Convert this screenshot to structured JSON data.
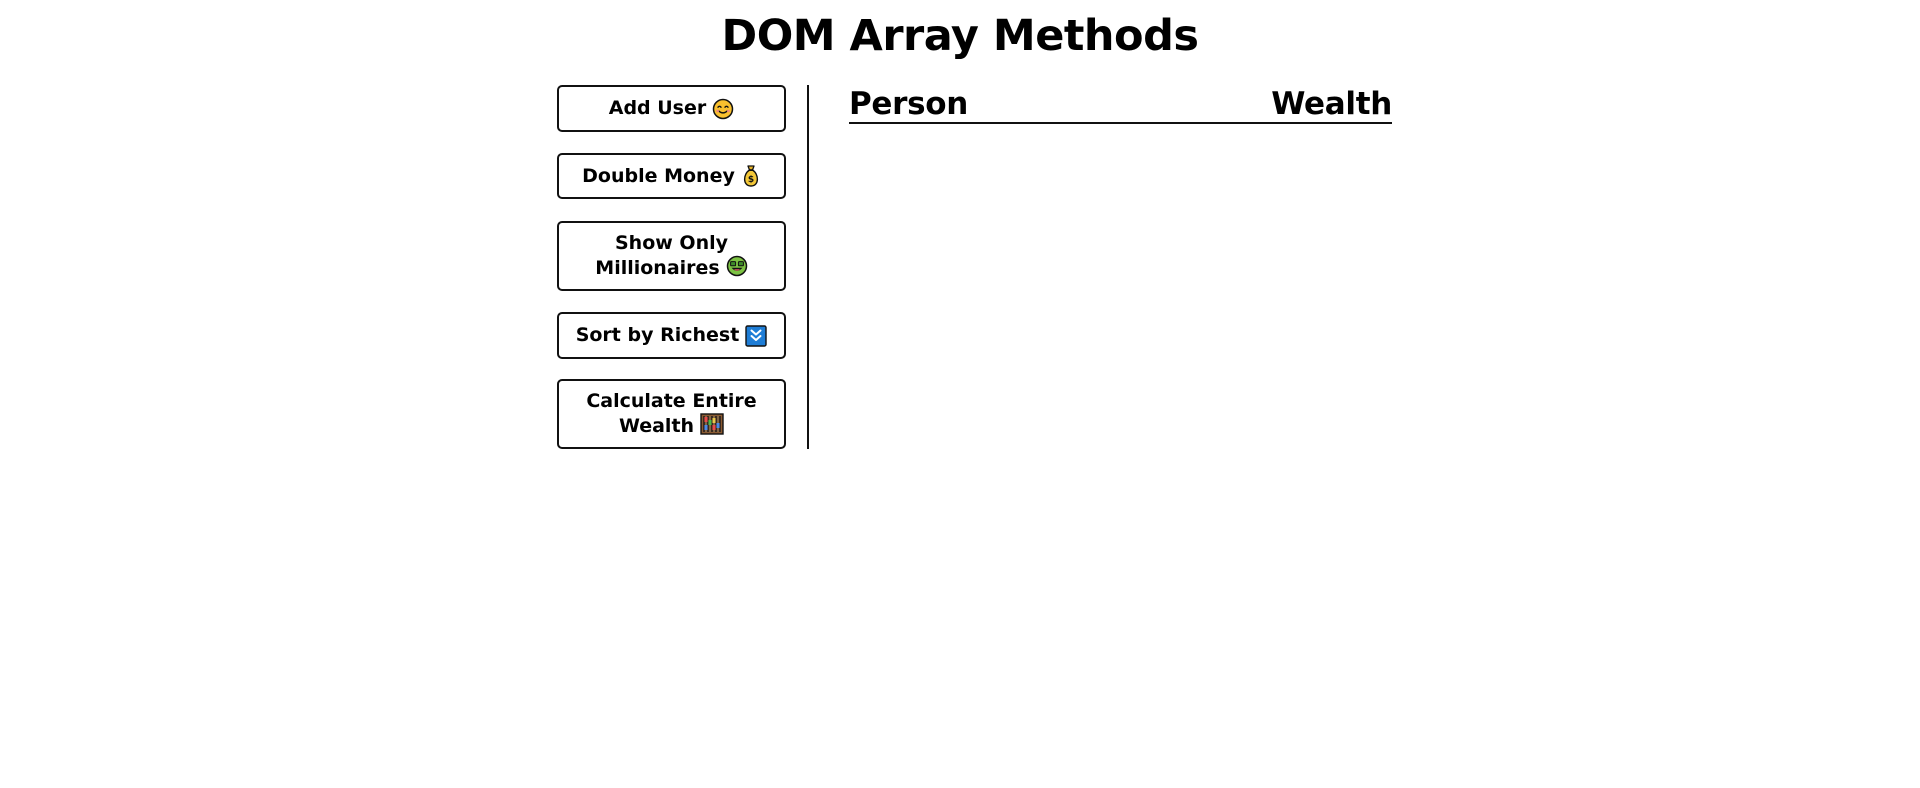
{
  "header": {
    "title": "DOM Array Methods"
  },
  "aside": {
    "buttons": [
      {
        "label": "Add User",
        "icon": "smiling-face-icon"
      },
      {
        "label": "Double Money",
        "icon": "money-bag-icon"
      },
      {
        "label": "Show Only Millionaires",
        "icon": "money-mouth-face-icon"
      },
      {
        "label": "Sort by Richest",
        "icon": "down-arrows-icon"
      },
      {
        "label": "Calculate Entire Wealth",
        "icon": "abacus-icon"
      }
    ]
  },
  "main": {
    "columns": {
      "person": "Person",
      "wealth": "Wealth"
    }
  }
}
